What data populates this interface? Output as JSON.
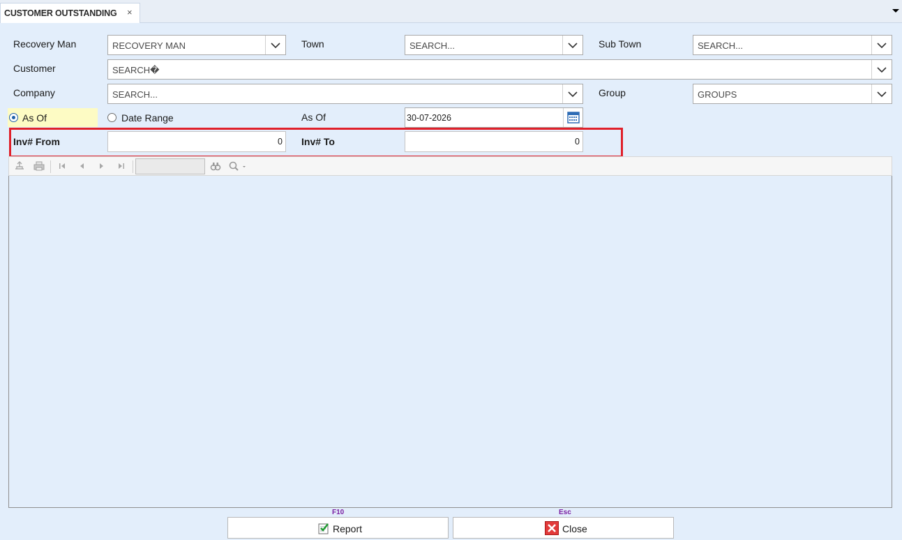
{
  "tab": {
    "title": "CUSTOMER OUTSTANDING",
    "close": "×"
  },
  "filters": {
    "recovery_man": {
      "label": "Recovery Man",
      "value": "RECOVERY MAN"
    },
    "town": {
      "label": "Town",
      "value": "SEARCH..."
    },
    "sub_town": {
      "label": "Sub Town",
      "value": "SEARCH..."
    },
    "customer": {
      "label": "Customer",
      "value": "SEARCH�"
    },
    "company": {
      "label": "Company",
      "value": "SEARCH..."
    },
    "group": {
      "label": "Group",
      "value": "GROUPS"
    },
    "as_of_radio": {
      "label": "As Of",
      "selected": true
    },
    "date_range_radio": {
      "label": "Date Range",
      "selected": false
    },
    "as_of_date": {
      "label": "As Of",
      "value": "30-07-2026"
    },
    "inv_from": {
      "label": "Inv# From",
      "value": "0"
    },
    "inv_to": {
      "label": "Inv# To",
      "value": "0"
    }
  },
  "viewer_toolbar": {
    "icons": [
      "export-icon",
      "print-icon",
      "first-page-icon",
      "prev-page-icon",
      "next-page-icon",
      "last-page-icon",
      "find-icon",
      "zoom-icon"
    ],
    "page_value": ""
  },
  "buttons": {
    "report": {
      "label": "Report",
      "shortcut": "F10"
    },
    "close": {
      "label": "Close",
      "shortcut": "Esc"
    }
  },
  "colors": {
    "highlight": "#e0202a",
    "background": "#e3eefb",
    "selected_radio_bg": "#fdfbc4",
    "shortcut": "#7a1fa2"
  }
}
